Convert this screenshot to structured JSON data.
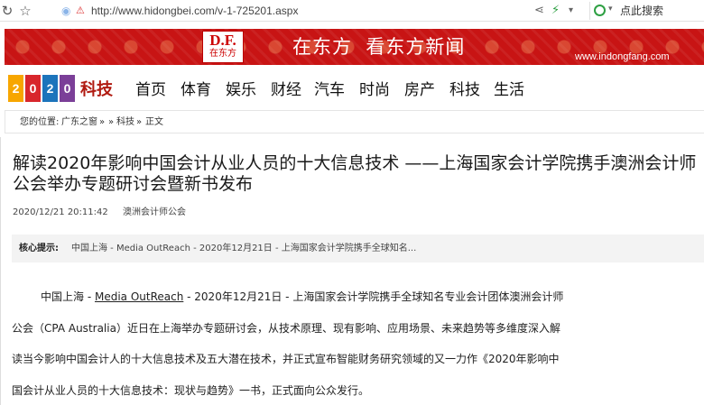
{
  "browser": {
    "url": "http://www.hidongbei.com/v-1-725201.aspx",
    "search_placeholder": "点此搜索",
    "icons": [
      "refresh-icon",
      "star-icon",
      "globe-icon",
      "security-warning-icon",
      "share-icon",
      "lightning-icon",
      "chevron-down-icon",
      "search-engine-logo"
    ]
  },
  "banner": {
    "logo_big": "D.F.",
    "logo_small": "在东方",
    "slogan": "在东方  看东方新闻",
    "url": "www.indongfang.com"
  },
  "site": {
    "logo_chars": [
      "2",
      "0",
      "2",
      "0"
    ],
    "logo_colors": [
      "#f7a600",
      "#d8262c",
      "#1c74bb",
      "#7b3f98"
    ],
    "section": "科技",
    "nav": [
      "首页",
      "体育",
      "娱乐",
      "财经",
      "汽车",
      "时尚",
      "房产",
      "科技",
      "生活"
    ]
  },
  "breadcrumb": {
    "prefix": "您的位置:",
    "home": "广东之窗",
    "sep1": "»",
    "sep2": "»",
    "category": "科技",
    "sep3": "»",
    "current": "正文"
  },
  "article": {
    "title": "解读2020年影响中国会计从业人员的十大信息技术 ——上海国家会计学院携手澳洲会计师公会举办专题研讨会暨新书发布",
    "datetime": "2020/12/21 20:11:42",
    "source": "澳洲会计师公会",
    "summary_label": "核心提示:",
    "summary_text": "中国上海 - Media OutReach - 2020年12月21日 - 上海国家会计学院携手全球知名...",
    "body": {
      "line1_pre": "中国上海 - ",
      "line1_link": "Media OutReach",
      "line1_post": " - 2020年12月21日 - 上海国家会计学院携手全球知名专业会计团体澳洲会计师",
      "line2": "公会（CPA Australia）近日在上海举办专题研讨会，从技术原理、现有影响、应用场景、未来趋势等多维度深入解",
      "line3": "读当今影响中国会计人的十大信息技术及五大潜在技术，并正式宣布智能财务研究领域的又一力作《2020年影响中",
      "line4": "国会计从业人员的十大信息技术：现状与趋势》一书，正式面向公众发行。"
    }
  },
  "colors": {
    "banner_red": "#c81414",
    "section_red": "#b01a10"
  }
}
